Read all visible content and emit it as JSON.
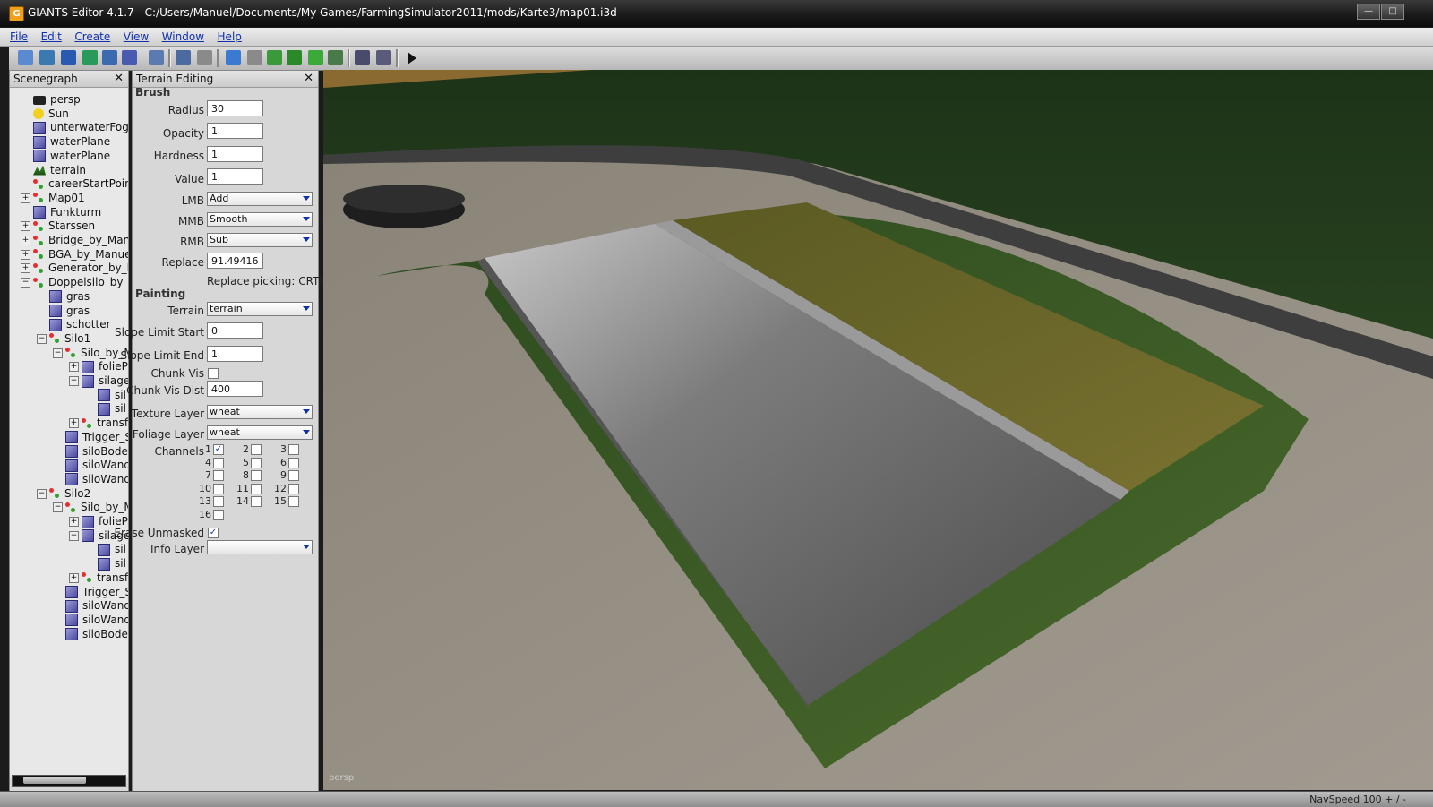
{
  "window": {
    "icon_letter": "G",
    "title": "GIANTS Editor 4.1.7 - C:/Users/Manuel/Documents/My Games/FarmingSimulator2011/mods/Karte3/map01.i3d"
  },
  "menu": [
    "File",
    "Edit",
    "Create",
    "View",
    "Window",
    "Help"
  ],
  "scenegraph": {
    "title": "Scenegraph",
    "close": "✕",
    "nodes": [
      "persp",
      "Sun",
      "unterwaterFog",
      "waterPlane",
      "waterPlane",
      "terrain",
      "careerStartPoin",
      "Map01",
      "Funkturm",
      "Starssen",
      "Bridge_by_Man",
      "BGA_by_Manue",
      "Generator_by_M",
      "Doppelsilo_by_M",
      "gras",
      "gras",
      "schotter",
      "Silo1",
      "Silo_by_M",
      "folieP",
      "silage",
      "sil",
      "sil",
      "transf",
      "Trigger_S",
      "siloBoder",
      "siloWand",
      "siloWand",
      "Silo2",
      "Silo_by_M",
      "folieP",
      "silage",
      "sil",
      "sil",
      "transf",
      "Trigger_S",
      "siloWand",
      "siloWand",
      "siloBoder"
    ]
  },
  "terrain_editing": {
    "title": "Terrain Editing",
    "close": "✕",
    "brush_section": "Brush",
    "radius_label": "Radius",
    "radius_value": "30",
    "opacity_label": "Opacity",
    "opacity_value": "1",
    "hardness_label": "Hardness",
    "hardness_value": "1",
    "value_label": "Value",
    "value_value": "1",
    "lmb_label": "LMB",
    "lmb_value": "Add",
    "mmb_label": "MMB",
    "mmb_value": "Smooth",
    "rmb_label": "RMB",
    "rmb_value": "Sub",
    "replace_label": "Replace",
    "replace_value": "91.49416",
    "replace_hint": "Replace picking: CRTL-R",
    "painting_section": "Painting",
    "terrain_label": "Terrain",
    "terrain_value": "terrain",
    "slope_start_label": "Slope Limit Start",
    "slope_start_value": "0",
    "slope_end_label": "Slope Limit End",
    "slope_end_value": "1",
    "chunk_vis_label": "Chunk Vis",
    "chunk_vis_dist_label": "Chunk Vis Dist",
    "chunk_vis_dist_value": "400",
    "texture_layer_label": "Texture Layer",
    "texture_layer_value": "wheat",
    "foliage_layer_label": "Foliage Layer",
    "foliage_layer_value": "wheat",
    "channels_label": "Channels",
    "channels": [
      "1",
      "2",
      "3",
      "4",
      "5",
      "6",
      "7",
      "8",
      "9",
      "10",
      "11",
      "12",
      "13",
      "14",
      "15",
      "16"
    ],
    "channels_checked": [
      true,
      false,
      false,
      false,
      false,
      false,
      false,
      false,
      false,
      false,
      false,
      false,
      false,
      false,
      false,
      false
    ],
    "erase_unmasked_label": "Erase Unmasked",
    "erase_unmasked_checked": true,
    "info_layer_label": "Info Layer",
    "info_layer_value": ""
  },
  "viewport": {
    "camera_label": "persp"
  },
  "status": {
    "nav_speed": "NavSpeed 100 + / -"
  }
}
